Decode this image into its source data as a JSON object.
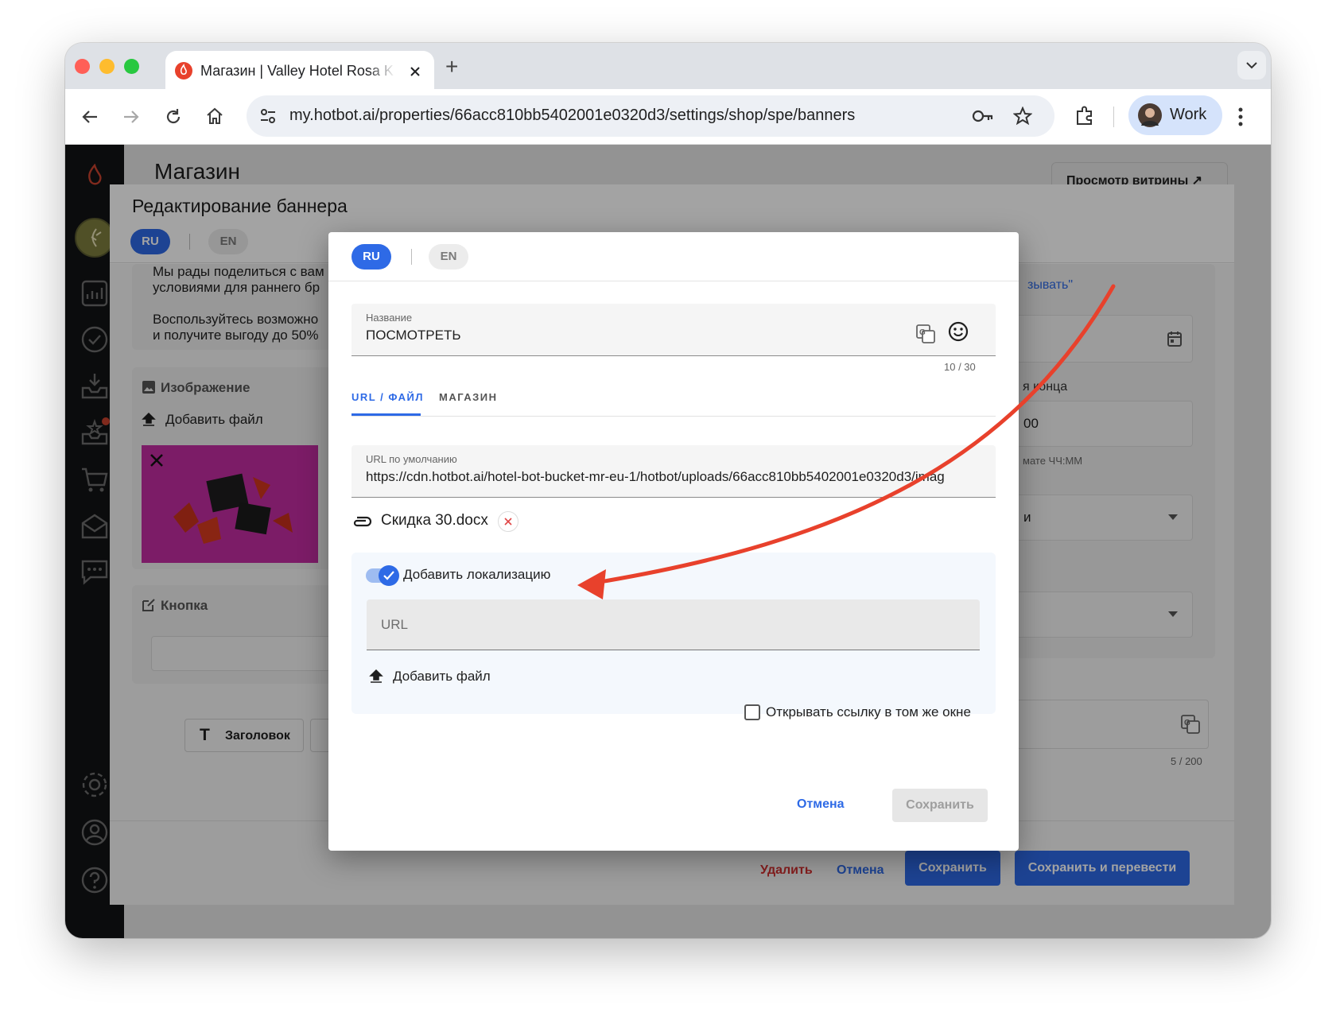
{
  "browser": {
    "tab_title": "Магазин | Valley Hotel Rosa K",
    "new_tab": "+",
    "url": "my.hotbot.ai/properties/66acc810bb5402001e0320d3/settings/shop/spe/banners",
    "profile_label": "Work"
  },
  "page": {
    "title": "Магазин",
    "storefront_button": "Просмотр витрины ↗"
  },
  "outer_dialog": {
    "title": "Редактирование баннера",
    "lang_active": "RU",
    "lang_inactive": "EN",
    "description_lines": [
      "Мы рады поделиться с вам",
      "условиями для раннего бр",
      "",
      "Воспользуйтесь возможно",
      "и получите выгоду до 50%"
    ],
    "image_section_label": "Изображение",
    "add_file_label": "Добавить файл",
    "button_section_label": "Кнопка",
    "heading_tool_label": "Заголовок",
    "right_link_fragment": "зывать\"",
    "end_date_label_fragment": "я конца",
    "time_value_fragment": "00",
    "time_hint_fragment": "мате ЧЧ:ММ",
    "select_value_fragment": "и",
    "char_counter": "5 / 200",
    "delete_label": "Удалить",
    "cancel_label": "Отмена",
    "save_label": "Сохранить",
    "save_translate_label": "Сохранить и перевести"
  },
  "inner_dialog": {
    "lang_active": "RU",
    "lang_inactive": "EN",
    "name_label": "Название",
    "name_value": "ПОСМОТРЕТЬ",
    "name_counter": "10 / 30",
    "tabs": [
      "URL / ФАЙЛ",
      "МАГАЗИН"
    ],
    "active_tab": "URL / ФАЙЛ",
    "default_url_label": "URL по умолчанию",
    "default_url_value": "https://cdn.hotbot.ai/hotel-bot-bucket-mr-eu-1/hotbot/uploads/66acc810bb5402001e0320d3/imag",
    "attachment_name": "Скидка 30.docx",
    "localization_toggle_label": "Добавить локализацию",
    "localization_enabled": true,
    "localization_url_placeholder": "URL",
    "add_file_label": "Добавить файл",
    "same_window_label": "Открывать ссылку в том же окне",
    "same_window_checked": false,
    "cancel_label": "Отмена",
    "save_label": "Сохранить"
  },
  "colors": {
    "accent": "#2e6ae6",
    "danger": "#d32f2f",
    "annotation_arrow": "#e8412c"
  }
}
